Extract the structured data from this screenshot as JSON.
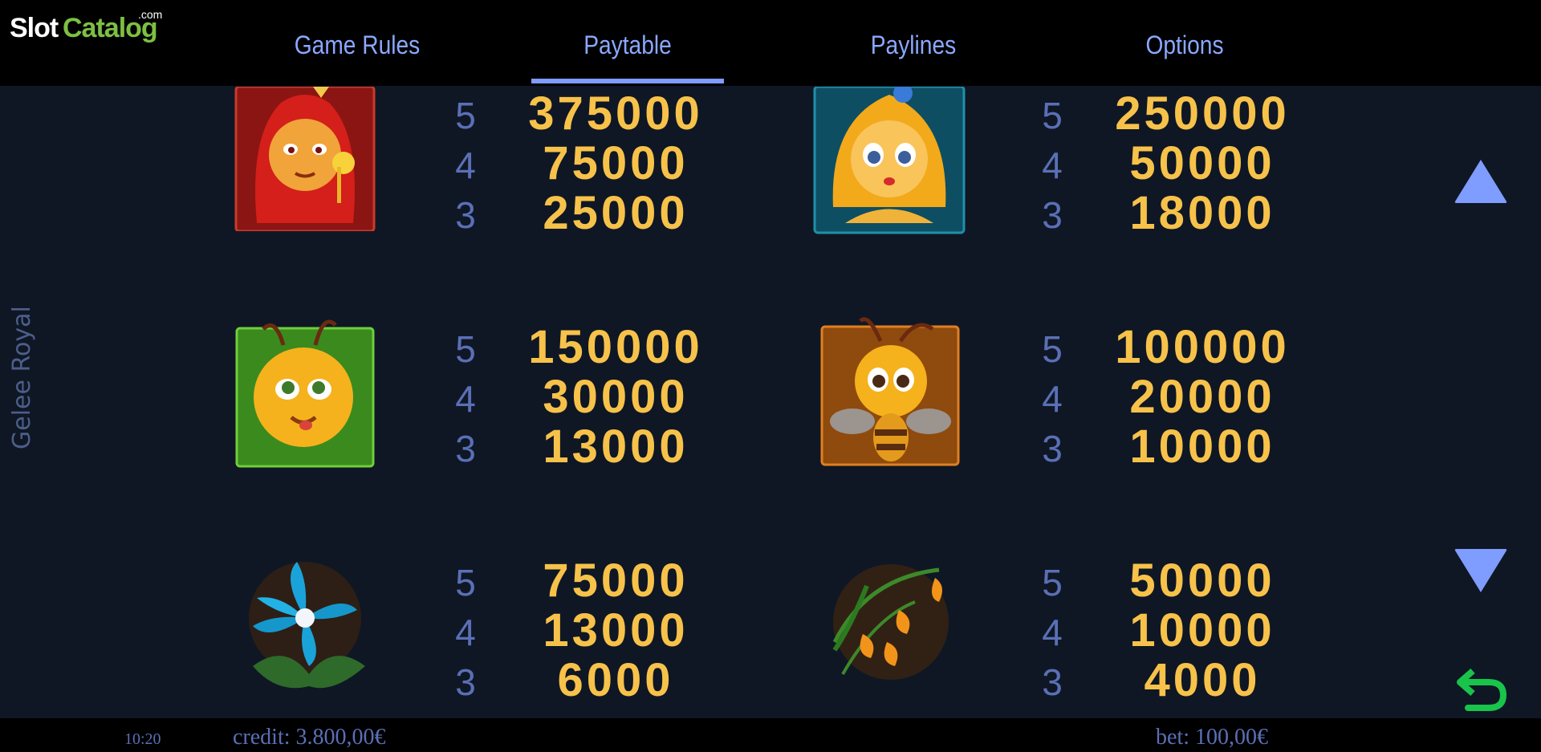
{
  "brand": {
    "logo_slot": "Slot",
    "logo_catalog": "Catalog",
    "logo_com": ".com"
  },
  "tabs": [
    {
      "label": "Game Rules",
      "active": false
    },
    {
      "label": "Paytable",
      "active": true
    },
    {
      "label": "Paylines",
      "active": false
    },
    {
      "label": "Options",
      "active": false
    }
  ],
  "game_title": "Gelee Royal",
  "paytable": [
    {
      "symbol": "queen-bee-red-hair",
      "rows": [
        {
          "count": "5",
          "payout": "375000"
        },
        {
          "count": "4",
          "payout": "75000"
        },
        {
          "count": "3",
          "payout": "25000"
        }
      ]
    },
    {
      "symbol": "blonde-bee-girl",
      "rows": [
        {
          "count": "5",
          "payout": "250000"
        },
        {
          "count": "4",
          "payout": "50000"
        },
        {
          "count": "3",
          "payout": "18000"
        }
      ]
    },
    {
      "symbol": "yellow-bee-green-frame",
      "rows": [
        {
          "count": "5",
          "payout": "150000"
        },
        {
          "count": "4",
          "payout": "30000"
        },
        {
          "count": "3",
          "payout": "13000"
        }
      ]
    },
    {
      "symbol": "baby-bee-orange-frame",
      "rows": [
        {
          "count": "5",
          "payout": "100000"
        },
        {
          "count": "4",
          "payout": "20000"
        },
        {
          "count": "3",
          "payout": "10000"
        }
      ]
    },
    {
      "symbol": "blue-flower",
      "rows": [
        {
          "count": "5",
          "payout": "75000"
        },
        {
          "count": "4",
          "payout": "13000"
        },
        {
          "count": "3",
          "payout": "6000"
        }
      ]
    },
    {
      "symbol": "orange-bellflowers",
      "rows": [
        {
          "count": "5",
          "payout": "50000"
        },
        {
          "count": "4",
          "payout": "10000"
        },
        {
          "count": "3",
          "payout": "4000"
        }
      ]
    }
  ],
  "footer": {
    "time": "10:20",
    "credit": "credit: 3.800,00€",
    "bet": "bet: 100,00€"
  },
  "colors": {
    "accent": "#8aa8ff",
    "payout": "#f7c24a",
    "count": "#5a6fb5",
    "back": "#22c55e"
  }
}
